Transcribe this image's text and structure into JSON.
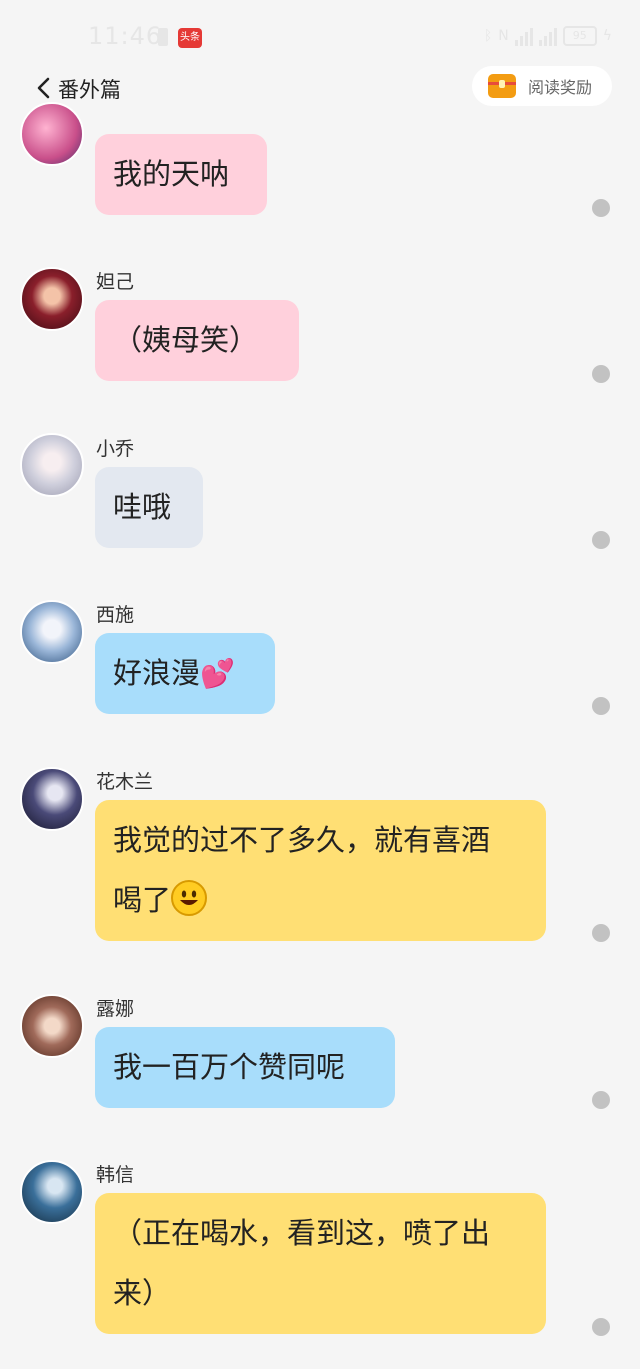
{
  "status_bar": {
    "time": "11:46",
    "app_badge": "头条",
    "battery": "95"
  },
  "header": {
    "title": "番外篇",
    "reward_label": "阅读奖励"
  },
  "messages": [
    {
      "sender": "",
      "text": "我的天呐",
      "bubble_color": "#ffd0dc"
    },
    {
      "sender": "妲己",
      "text": "（姨母笑）",
      "bubble_color": "#ffd0dc"
    },
    {
      "sender": "小乔",
      "text": "哇哦",
      "bubble_color": "#e3e8f0"
    },
    {
      "sender": "西施",
      "text": "好浪漫",
      "emoji": "💕",
      "bubble_color": "#a8ddfb"
    },
    {
      "sender": "花木兰",
      "text_line1": "我觉的过不了多久，就有喜酒",
      "text_line2": "喝了",
      "emoji": "😃",
      "bubble_color": "#ffdf74"
    },
    {
      "sender": "露娜",
      "text": "我一百万个赞同呢",
      "bubble_color": "#a8ddfb"
    },
    {
      "sender": "韩信",
      "text_line1": "（正在喝水，看到这，喷了出",
      "text_line2": "来）",
      "bubble_color": "#ffdf74"
    }
  ],
  "avatar_colors": [
    "#c94f8a",
    "#8a1f2b",
    "#dcdce6",
    "#9ab6d8",
    "#4a4a78",
    "#a06a5a",
    "#3a6f9a"
  ]
}
